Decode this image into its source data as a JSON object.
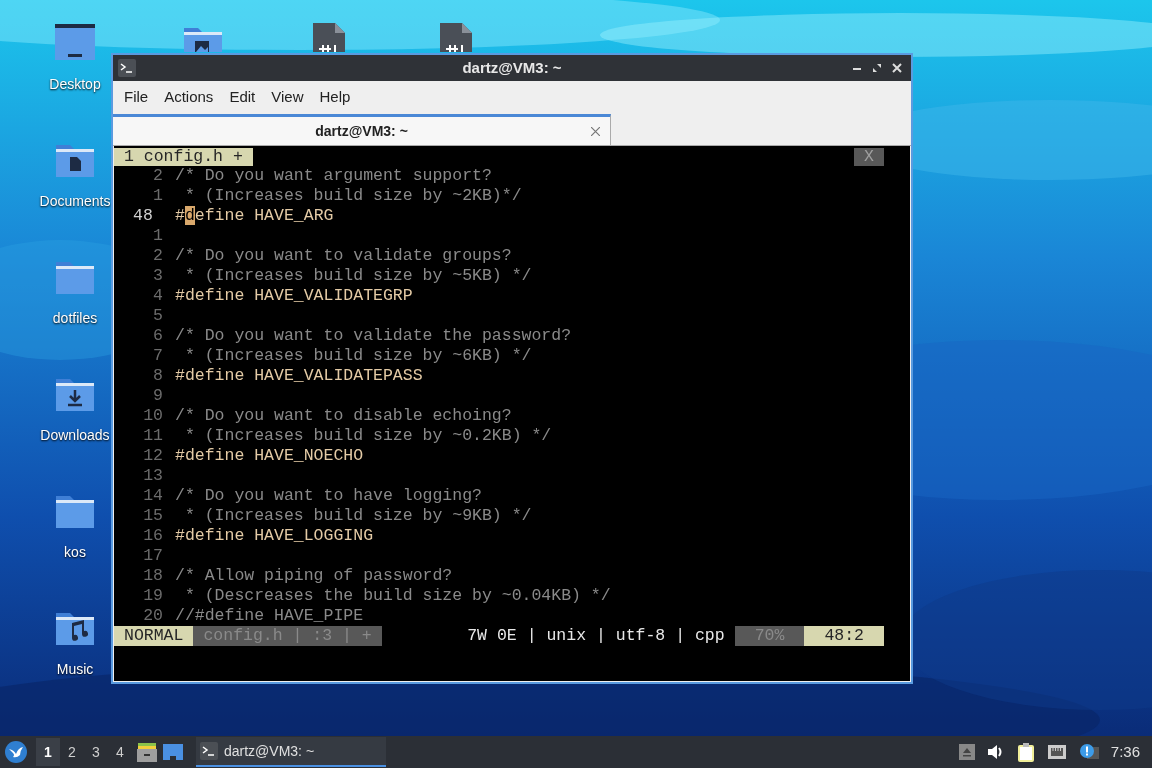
{
  "desktop_icons": [
    {
      "label": "Desktop",
      "kind": "desktop"
    },
    {
      "label": "Documents",
      "kind": "documents"
    },
    {
      "label": "dotfiles",
      "kind": "folder"
    },
    {
      "label": "Downloads",
      "kind": "downloads"
    },
    {
      "label": "kos",
      "kind": "folder"
    },
    {
      "label": "Music",
      "kind": "music"
    }
  ],
  "window": {
    "title": "dartz@VM3: ~"
  },
  "menu": [
    "File",
    "Actions",
    "Edit",
    "View",
    "Help"
  ],
  "tabs": [
    {
      "label": "dartz@VM3: ~",
      "selected": true
    }
  ],
  "vim": {
    "tabline": {
      "tab": "1 config.h +",
      "close": "X"
    },
    "lines": [
      {
        "number": "2",
        "kind": "comment",
        "current": false,
        "text": "/* Do you want argument support?"
      },
      {
        "number": "1",
        "kind": "comment",
        "current": false,
        "text": " * (Increases build size by ~2KB)*/"
      },
      {
        "number": "48",
        "kind": "define",
        "current": true,
        "text": "#",
        "cursor": "d",
        "rest": "efine HAVE_ARG"
      },
      {
        "number": "1",
        "kind": "blank",
        "current": false
      },
      {
        "number": "2",
        "kind": "comment",
        "current": false,
        "text": "/* Do you want to validate groups?"
      },
      {
        "number": "3",
        "kind": "comment",
        "current": false,
        "text": " * (Increases build size by ~5KB) */"
      },
      {
        "number": "4",
        "kind": "define",
        "current": false,
        "text": "#define HAVE_VALIDATEGRP"
      },
      {
        "number": "5",
        "kind": "blank",
        "current": false
      },
      {
        "number": "6",
        "kind": "comment",
        "current": false,
        "text": "/* Do you want to validate the password?"
      },
      {
        "number": "7",
        "kind": "comment",
        "current": false,
        "text": " * (Increases build size by ~6KB) */"
      },
      {
        "number": "8",
        "kind": "define",
        "current": false,
        "text": "#define HAVE_VALIDATEPASS"
      },
      {
        "number": "9",
        "kind": "blank",
        "current": false
      },
      {
        "number": "10",
        "kind": "comment",
        "current": false,
        "text": "/* Do you want to disable echoing?"
      },
      {
        "number": "11",
        "kind": "comment",
        "current": false,
        "text": " * (Increases build size by ~0.2KB) */"
      },
      {
        "number": "12",
        "kind": "define",
        "current": false,
        "text": "#define HAVE_NOECHO"
      },
      {
        "number": "13",
        "kind": "blank",
        "current": false
      },
      {
        "number": "14",
        "kind": "comment",
        "current": false,
        "text": "/* Do you want to have logging?"
      },
      {
        "number": "15",
        "kind": "comment",
        "current": false,
        "text": " * (Increases build size by ~9KB) */"
      },
      {
        "number": "16",
        "kind": "define",
        "current": false,
        "text": "#define HAVE_LOGGING"
      },
      {
        "number": "17",
        "kind": "blank",
        "current": false
      },
      {
        "number": "18",
        "kind": "comment",
        "current": false,
        "text": "/* Allow piping of password?"
      },
      {
        "number": "19",
        "kind": "comment",
        "current": false,
        "text": " * (Descreases the build size by ~0.04KB) */"
      },
      {
        "number": "20",
        "kind": "comment",
        "current": false,
        "text": "//#define HAVE_PIPE"
      }
    ],
    "statusline": {
      "mode": "NORMAL",
      "file": "config.h | :3 | +",
      "info": "7W 0E | unix | utf-8 | cpp",
      "percent": "70%",
      "position": "48:2"
    }
  },
  "taskbar": {
    "workspaces": [
      {
        "label": "1",
        "selected": true
      },
      {
        "label": "2",
        "selected": false
      },
      {
        "label": "3",
        "selected": false
      },
      {
        "label": "4",
        "selected": false
      }
    ],
    "tasks": [
      {
        "label": "dartz@VM3: ~",
        "selected": true
      }
    ],
    "clock": "7:36"
  }
}
